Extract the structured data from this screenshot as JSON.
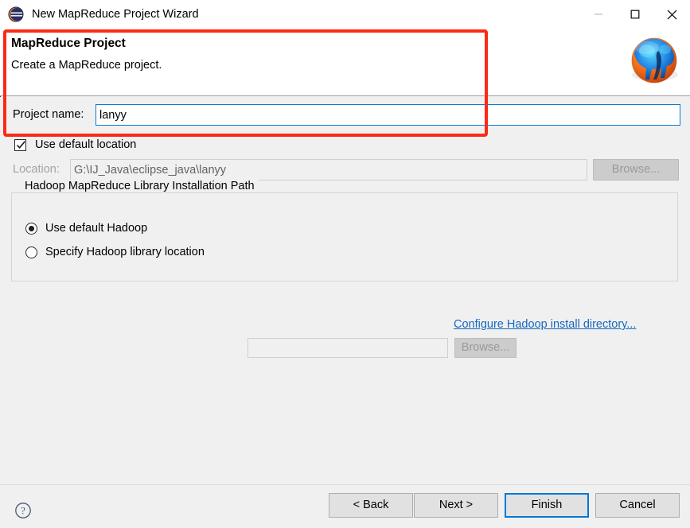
{
  "window": {
    "title": "New MapReduce Project Wizard",
    "icon": "eclipse-icon",
    "minimize_label": "–",
    "maximize_label": "□",
    "close_label": "✕"
  },
  "header": {
    "title": "MapReduce Project",
    "description": "Create a MapReduce project.",
    "logo": "hadoop-elephant-logo"
  },
  "form": {
    "project_name_label": "Project name:",
    "project_name_value": "lanyy",
    "use_default_location_label": "Use default location",
    "use_default_location_checked": true,
    "location_label": "Location:",
    "location_value": "G:\\IJ_Java\\eclipse_java\\lanyy",
    "browse_label": "Browse..."
  },
  "hadoop_group": {
    "title": "Hadoop MapReduce Library Installation Path",
    "use_default_label": "Use default Hadoop",
    "use_default_selected": true,
    "specify_label": "Specify Hadoop library location",
    "specify_selected": false,
    "specify_value": "",
    "configure_link": "Configure Hadoop install directory...",
    "browse_label": "Browse..."
  },
  "footer": {
    "help_label": "?",
    "back_label": "< Back",
    "next_label": "Next >",
    "finish_label": "Finish",
    "cancel_label": "Cancel"
  },
  "colors": {
    "accent_blue": "#0078d7",
    "link_blue": "#1668c1",
    "annotation_red": "#fb2a15",
    "dialog_bg": "#f0f0f0"
  }
}
